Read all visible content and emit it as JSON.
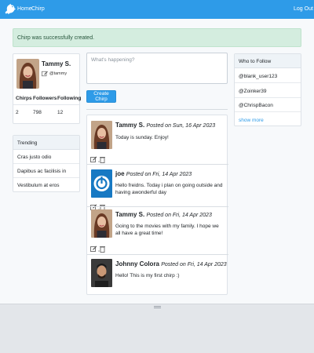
{
  "navbar": {
    "brand_icon": "bird-logo-icon",
    "home_label": "Home",
    "chirp_label": "Chirp",
    "logout_label": "Log Out",
    "color": "#2e9be8"
  },
  "alert": {
    "message": "Chirp was successfully created.",
    "color": "#d4eddf"
  },
  "profile": {
    "name": "Tammy S.",
    "handle": "@tammy",
    "stats": {
      "chirps_label": "Chirps",
      "followers_label": "Followers",
      "following_label": "Following",
      "chirps": "2",
      "followers": "798",
      "following": "12"
    }
  },
  "trending": {
    "title": "Trending",
    "items": [
      {
        "label": "Cras justo odio"
      },
      {
        "label": "Dapibus ac facilisis in"
      },
      {
        "label": "Vestibulum at eros"
      }
    ]
  },
  "compose": {
    "placeholder": "What's happening?",
    "button_label": "Create Chirp"
  },
  "feed": [
    {
      "author": "Tammy S.",
      "meta": "Posted on Sun, 16 Apr 2023",
      "body": "Today is sunday. Enjoy!",
      "avatar": "woman-photo"
    },
    {
      "author": "joe",
      "meta": "Posted on Fri, 14 Apr 2023",
      "body": "Hello freidns. Today i plan on going outside and having awonderful day",
      "avatar": "power-icon"
    },
    {
      "author": "Tammy S.",
      "meta": "Posted on Fri, 14 Apr 2023",
      "body": "Going to the movies with my family. I hope we all have a great time!",
      "avatar": "woman-photo"
    },
    {
      "author": "Johnny Colora",
      "meta": "Posted on Fri, 14 Apr 2023",
      "body": "Hello! This is my first chirp :)",
      "avatar": "man-photo"
    }
  ],
  "who_to_follow": {
    "title": "Who to Follow",
    "items": [
      {
        "label": "@blank_user123"
      },
      {
        "label": "@Zoinker39"
      },
      {
        "label": "@ChrispBacon"
      }
    ],
    "show_more_label": "show more"
  }
}
